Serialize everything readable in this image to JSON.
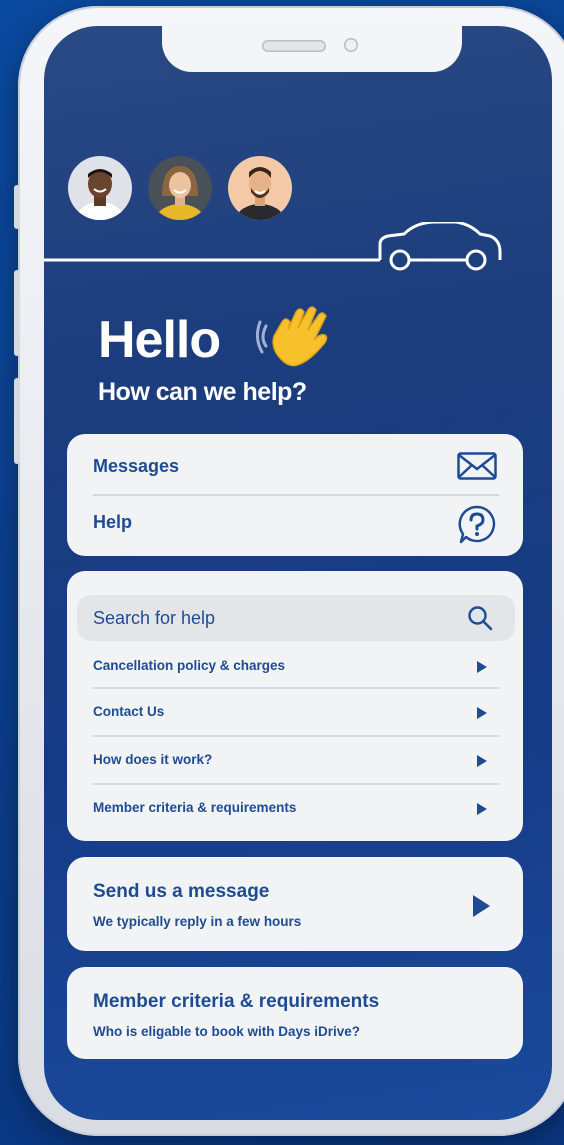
{
  "greeting": {
    "title": "Hello",
    "subtitle": "How can we help?"
  },
  "top_menu": {
    "messages_label": "Messages",
    "help_label": "Help"
  },
  "search": {
    "placeholder": "Search for help",
    "items": [
      {
        "label": "Cancellation policy & charges"
      },
      {
        "label": "Contact Us"
      },
      {
        "label": "How does it work?"
      },
      {
        "label": "Member criteria & requirements"
      }
    ]
  },
  "send_message": {
    "title": "Send us a message",
    "subtitle": "We typically reply in a few hours"
  },
  "member_card": {
    "title": "Member criteria & requirements",
    "subtitle": "Who is eligable to book with Days iDrive?"
  },
  "colors": {
    "primary": "#1d4c93",
    "card_bg": "#f2f3f5",
    "screen_bg": "#1c3d7d"
  },
  "icons": [
    "mail-icon",
    "help-bubble-icon",
    "search-icon",
    "chevron-right-icon",
    "car-icon",
    "wave-hand-icon"
  ]
}
